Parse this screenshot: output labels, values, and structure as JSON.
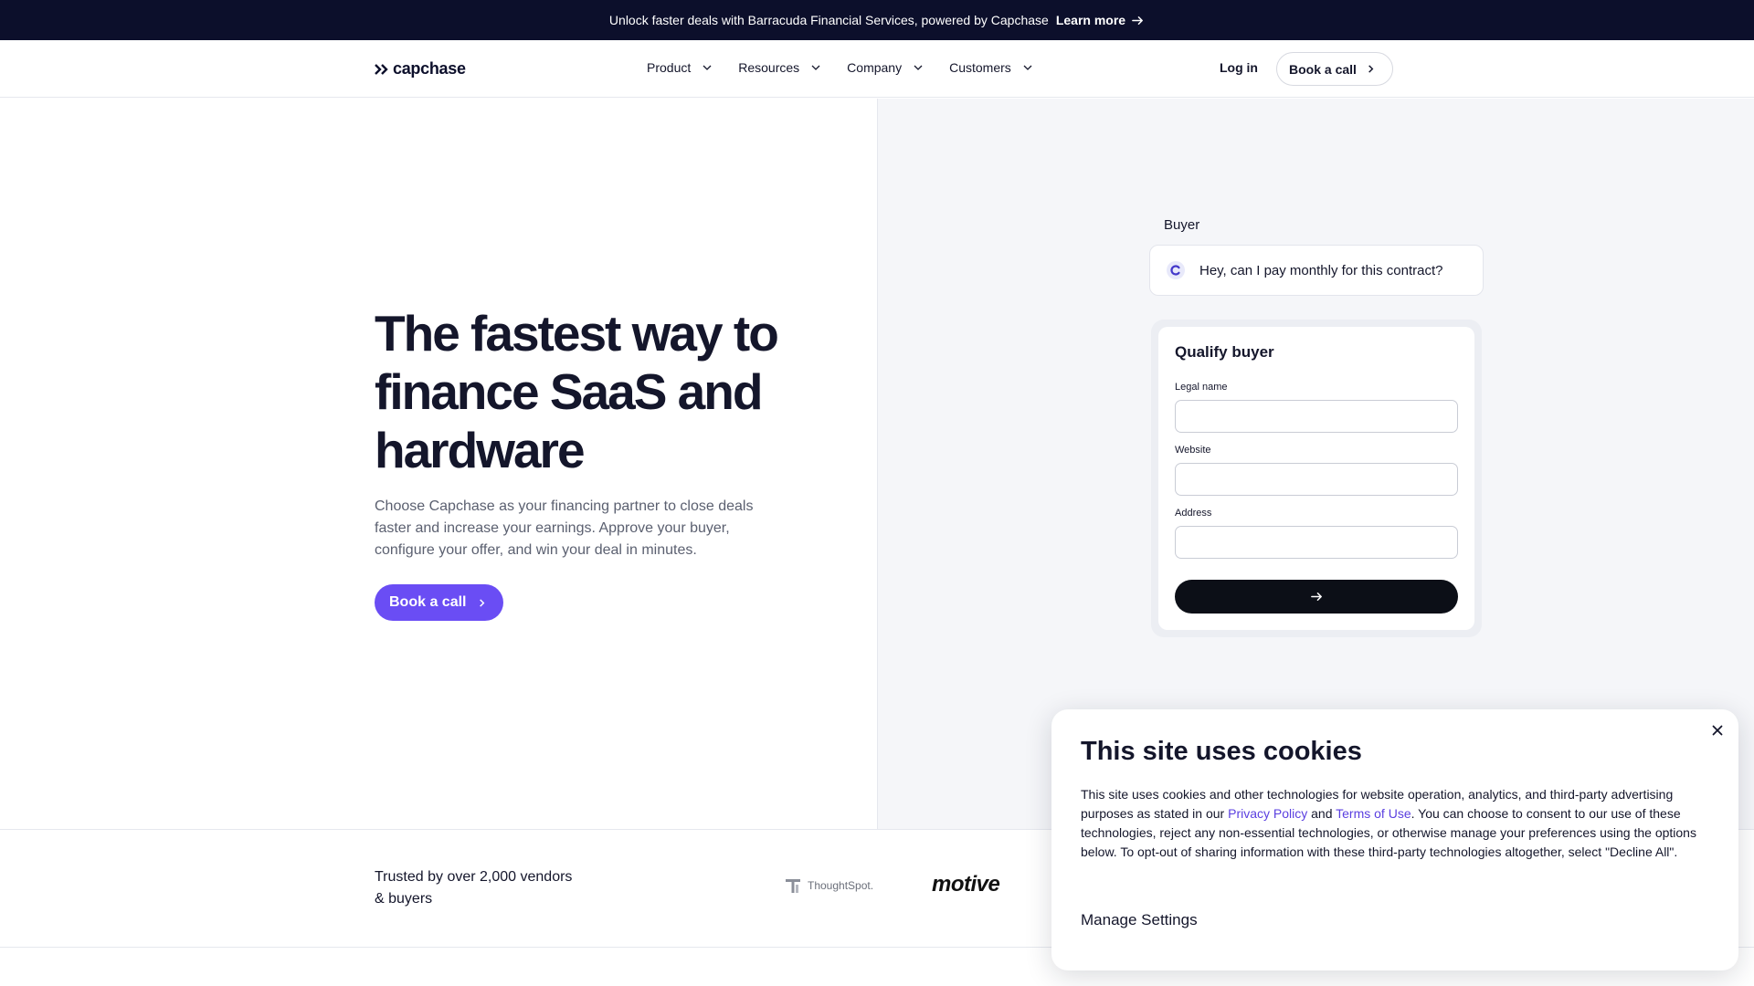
{
  "announcement": {
    "text": "Unlock faster deals with Barracuda Financial Services, powered by Capchase",
    "link": "Learn more"
  },
  "nav": {
    "logo": "capchase",
    "menu": [
      "Product",
      "Resources",
      "Company",
      "Customers"
    ],
    "login": "Log in",
    "book_call": "Book a call"
  },
  "hero": {
    "headline": "The fastest way to finance SaaS and hardware",
    "subtext": "Choose Capchase as your financing partner to close deals faster and increase your earnings. Approve your buyer, configure your offer, and win your deal in minutes.",
    "cta": "Book a call"
  },
  "demo": {
    "buyer_label": "Buyer",
    "message": "Hey, can I pay monthly for this contract?",
    "form_title": "Qualify buyer",
    "fields": [
      {
        "label": "Legal name",
        "value": ""
      },
      {
        "label": "Website",
        "value": ""
      },
      {
        "label": "Address",
        "value": ""
      }
    ]
  },
  "trusted": {
    "text": "Trusted by over 2,000 vendors & buyers",
    "logos": [
      "ThoughtSpot.",
      "motive"
    ]
  },
  "cookie": {
    "title": "This site uses cookies",
    "body_1": "This site uses cookies and other technologies for website operation, analytics, and third-party advertising purposes as stated in our ",
    "privacy_link": "Privacy Policy",
    "body_2": " and ",
    "terms_link": "Terms of Use",
    "body_3": ". You can choose to consent to our use of these technologies, reject any non-essential technologies, or otherwise manage your preferences using the options below. To opt-out of sharing information with these third-party technologies altogether, select \"Decline All\".",
    "manage": "Manage Settings"
  },
  "colors": {
    "announce_bg": "#0c0f2b",
    "accent": "#6a4df4",
    "link": "#5a3fe0",
    "panel_bg": "#f5f6f9"
  }
}
